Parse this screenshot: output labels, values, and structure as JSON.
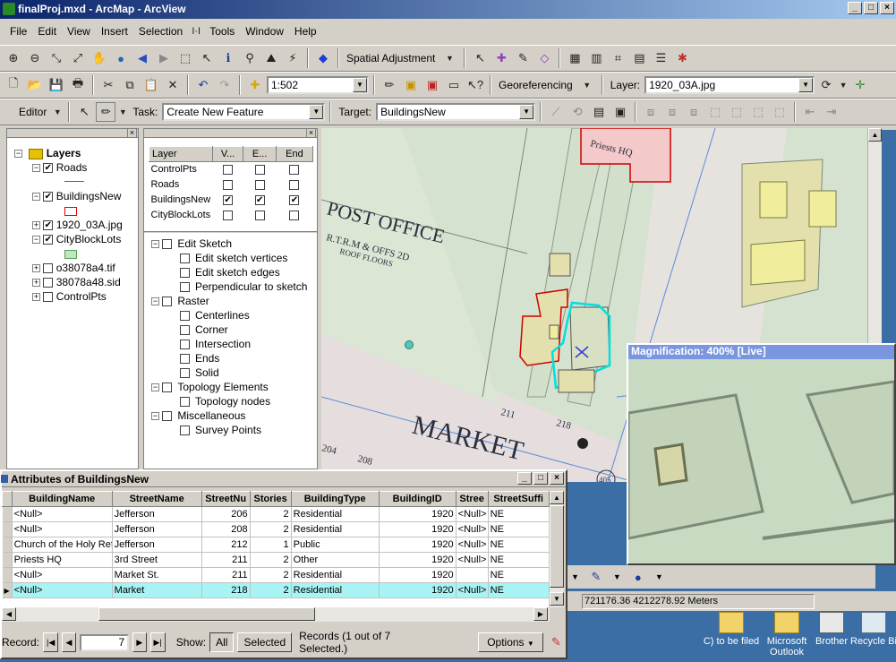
{
  "window": {
    "title": "finalProj.mxd - ArcMap - ArcView"
  },
  "menu": [
    "File",
    "Edit",
    "View",
    "Insert",
    "Selection",
    "Tools",
    "Window",
    "Help"
  ],
  "toolbar1": {
    "spatial_adjustment": "Spatial Adjustment"
  },
  "toolbar2": {
    "scale": "1:502",
    "georeferencing": "Georeferencing",
    "layer_label": "Layer:",
    "layer_value": "1920_03A.jpg"
  },
  "editor": {
    "editor_label": "Editor",
    "task_label": "Task:",
    "task_value": "Create New Feature",
    "target_label": "Target:",
    "target_value": "BuildingsNew"
  },
  "toc": {
    "root": "Layers",
    "items": [
      "Roads",
      "BuildingsNew",
      "1920_03A.jpg",
      "CityBlockLots",
      "o38078a4.tif",
      "38078a48.sid",
      "ControlPts"
    ]
  },
  "snapping": {
    "headers": [
      "Layer",
      "V...",
      "E...",
      "End"
    ],
    "rows": [
      {
        "name": "ControlPts"
      },
      {
        "name": "Roads"
      },
      {
        "name": "BuildingsNew"
      },
      {
        "name": "CityBlockLots"
      }
    ],
    "tree": [
      {
        "label": "Edit Sketch",
        "level": 0
      },
      {
        "label": "Edit sketch vertices",
        "level": 1
      },
      {
        "label": "Edit sketch edges",
        "level": 1
      },
      {
        "label": "Perpendicular to sketch",
        "level": 1
      },
      {
        "label": "Raster",
        "level": 0
      },
      {
        "label": "Centerlines",
        "level": 1
      },
      {
        "label": "Corner",
        "level": 1
      },
      {
        "label": "Intersection",
        "level": 1
      },
      {
        "label": "Ends",
        "level": 1
      },
      {
        "label": "Solid",
        "level": 1
      },
      {
        "label": "Topology Elements",
        "level": 0
      },
      {
        "label": "Topology nodes",
        "level": 1
      },
      {
        "label": "Miscellaneous",
        "level": 0
      },
      {
        "label": "Survey Points",
        "level": 1
      }
    ]
  },
  "map": {
    "labels": {
      "post_office": "POST OFFICE",
      "rooms": "R.T.R.M & OFFS 2D",
      "roof": "ROOF FLOORS",
      "market": "MARKET",
      "priests": "Priests HQ",
      "n211": "211",
      "n218": "218",
      "n204": "204",
      "n208": "208",
      "n405": "405"
    }
  },
  "magnifier": {
    "title": "Magnification: 400% [Live]"
  },
  "attributes": {
    "title": "Attributes of BuildingsNew",
    "columns": [
      "BuildingName",
      "StreetName",
      "StreetNu",
      "Stories",
      "BuildingType",
      "BuildingID",
      "Stree",
      "StreetSuffi"
    ],
    "rows": [
      [
        "<Null>",
        "Jefferson",
        "206",
        "2",
        "Residential",
        "1920",
        "<Null>",
        "NE"
      ],
      [
        "<Null>",
        "Jefferson",
        "208",
        "2",
        "Residential",
        "1920",
        "<Null>",
        "NE"
      ],
      [
        "Church of the Holy Ref",
        "Jefferson",
        "212",
        "1",
        "Public",
        "1920",
        "<Null>",
        "NE"
      ],
      [
        "Priests HQ",
        "3rd Street",
        "211",
        "2",
        "Other",
        "1920",
        "<Null>",
        "NE"
      ],
      [
        "<Null>",
        "Market St.",
        "211",
        "2",
        "Residential",
        "1920",
        "",
        "NE"
      ],
      [
        "<Null>",
        "Market",
        "218",
        "2",
        "Residential",
        "1920",
        "<Null>",
        "NE"
      ]
    ],
    "record_label": "Record:",
    "record_value": "7",
    "show_label": "Show:",
    "all_label": "All",
    "selected_label": "Selected",
    "records_text": "Records (1 out of 7 Selected.)",
    "options_label": "Options"
  },
  "status": {
    "coords": "721176.36  4212278.92 Meters"
  },
  "desktop": [
    {
      "label": "C) to be filed"
    },
    {
      "label": "Microsoft Outlook"
    },
    {
      "label": "Brother"
    },
    {
      "label": "Recycle Bin"
    }
  ]
}
